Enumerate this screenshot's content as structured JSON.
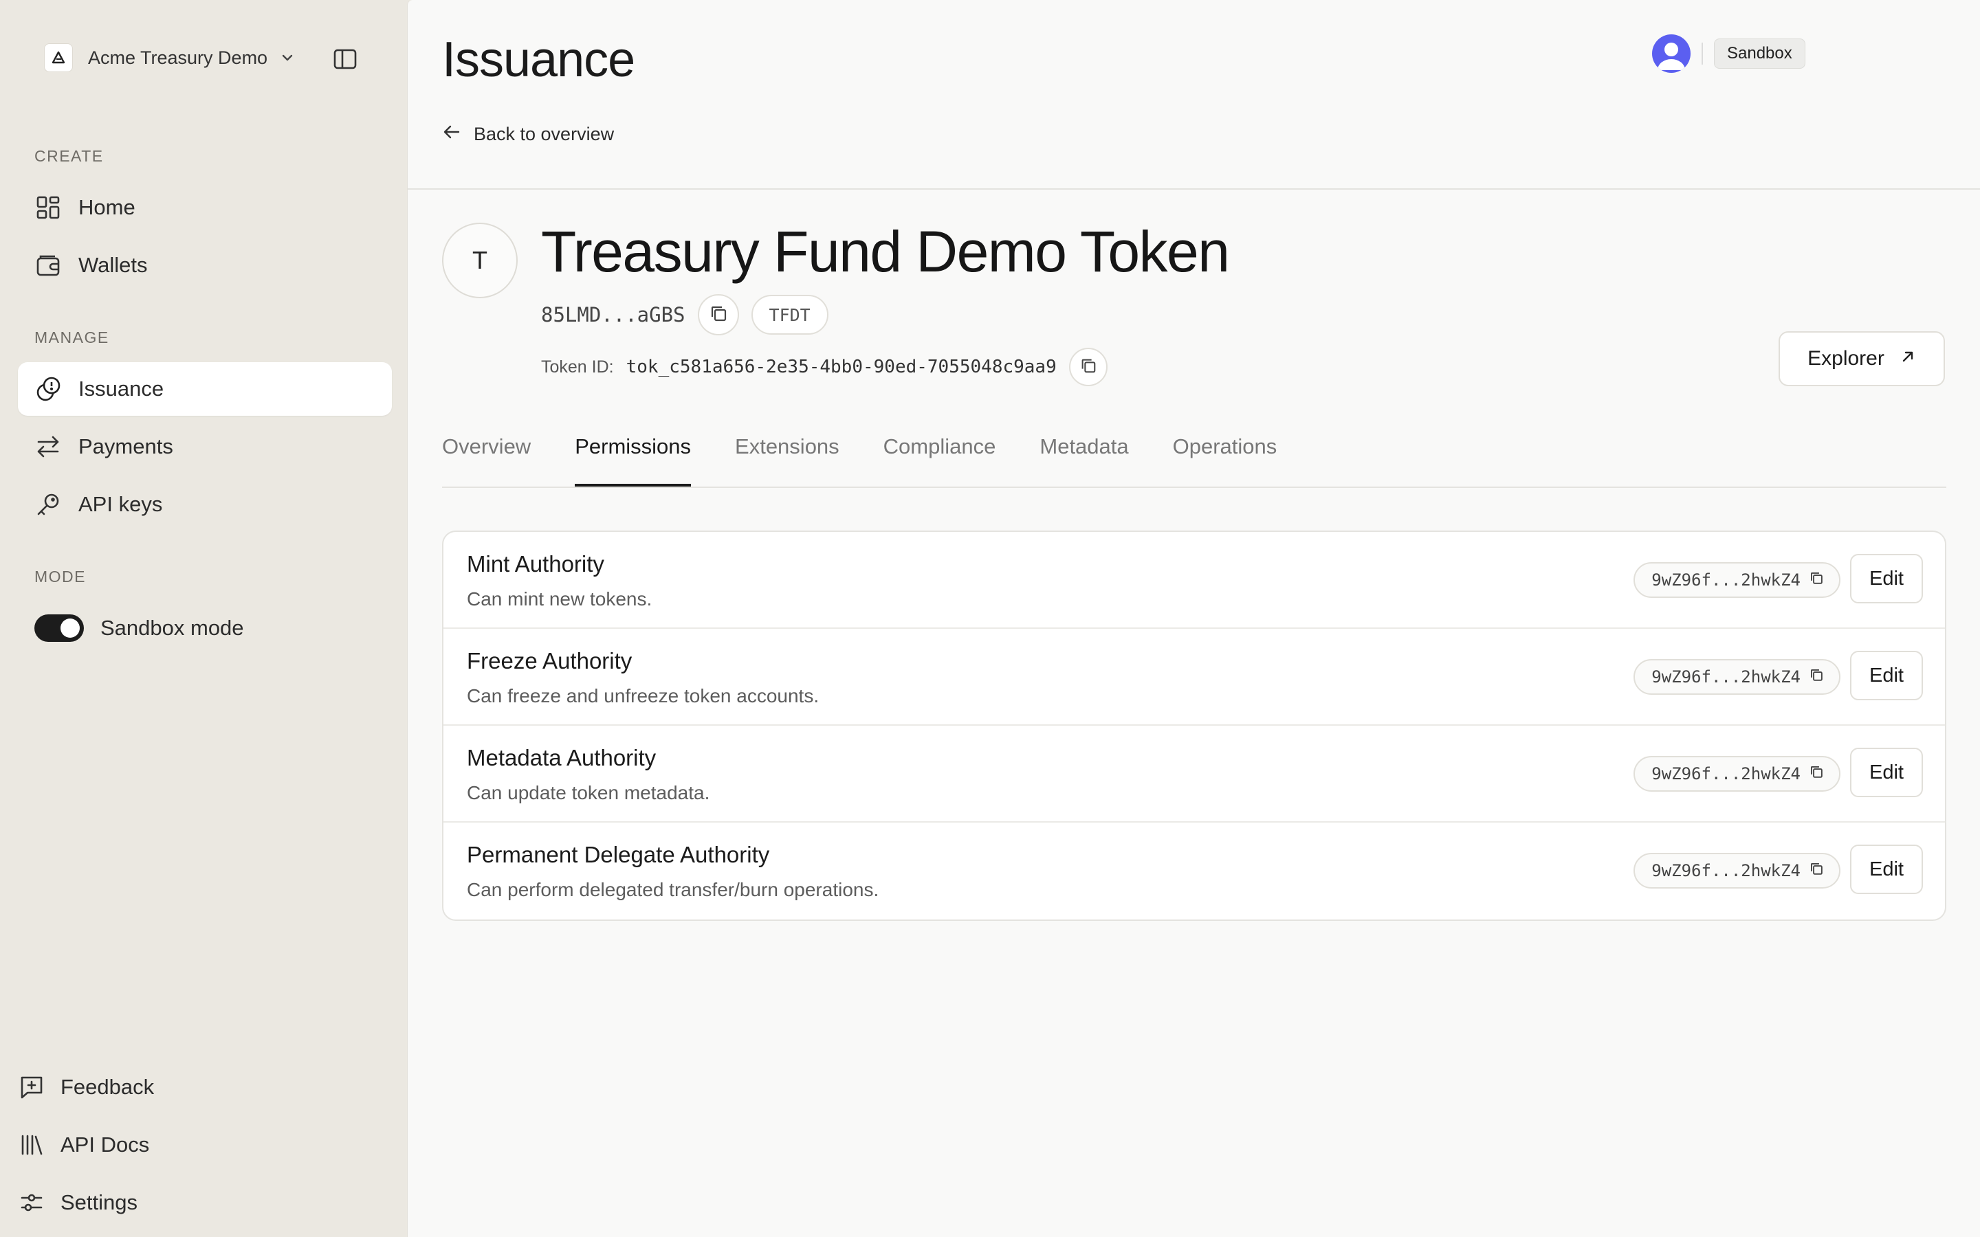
{
  "workspace": {
    "name": "Acme Treasury Demo"
  },
  "sidebar": {
    "sections": {
      "create": "CREATE",
      "manage": "MANAGE",
      "mode": "MODE"
    },
    "create_items": [
      {
        "label": "Home",
        "icon": "grid-icon"
      },
      {
        "label": "Wallets",
        "icon": "wallet-icon"
      }
    ],
    "manage_items": [
      {
        "label": "Issuance",
        "icon": "coins-icon",
        "active": true
      },
      {
        "label": "Payments",
        "icon": "arrows-exchange-icon"
      },
      {
        "label": "API keys",
        "icon": "key-icon"
      }
    ],
    "mode_toggle": {
      "label": "Sandbox mode",
      "on": true
    },
    "bottom_items": [
      {
        "label": "Feedback",
        "icon": "feedback-icon"
      },
      {
        "label": "API Docs",
        "icon": "library-icon"
      },
      {
        "label": "Settings",
        "icon": "sliders-icon"
      }
    ]
  },
  "header": {
    "title": "Issuance",
    "back_link": "Back to overview",
    "env_badge": "Sandbox"
  },
  "token": {
    "avatar_letter": "T",
    "name": "Treasury Fund Demo Token",
    "address_short": "85LMD...aGBS",
    "symbol": "TFDT",
    "token_id_label": "Token ID:",
    "token_id": "tok_c581a656-2e35-4bb0-90ed-7055048c9aa9",
    "explorer_label": "Explorer"
  },
  "tabs": [
    {
      "label": "Overview"
    },
    {
      "label": "Permissions",
      "active": true
    },
    {
      "label": "Extensions"
    },
    {
      "label": "Compliance"
    },
    {
      "label": "Metadata"
    },
    {
      "label": "Operations"
    }
  ],
  "permissions": [
    {
      "title": "Mint Authority",
      "description": "Can mint new tokens.",
      "address": "9wZ96f...2hwkZ4",
      "action": "Edit"
    },
    {
      "title": "Freeze Authority",
      "description": "Can freeze and unfreeze token accounts.",
      "address": "9wZ96f...2hwkZ4",
      "action": "Edit"
    },
    {
      "title": "Metadata Authority",
      "description": "Can update token metadata.",
      "address": "9wZ96f...2hwkZ4",
      "action": "Edit"
    },
    {
      "title": "Permanent Delegate Authority",
      "description": "Can perform delegated transfer/burn operations.",
      "address": "9wZ96f...2hwkZ4",
      "action": "Edit"
    }
  ],
  "colors": {
    "sidebar_bg": "#ebe8e1",
    "main_bg": "#f9f9f8",
    "avatar": "#5b5ff0",
    "toggle_on": "#1c1c1c"
  }
}
